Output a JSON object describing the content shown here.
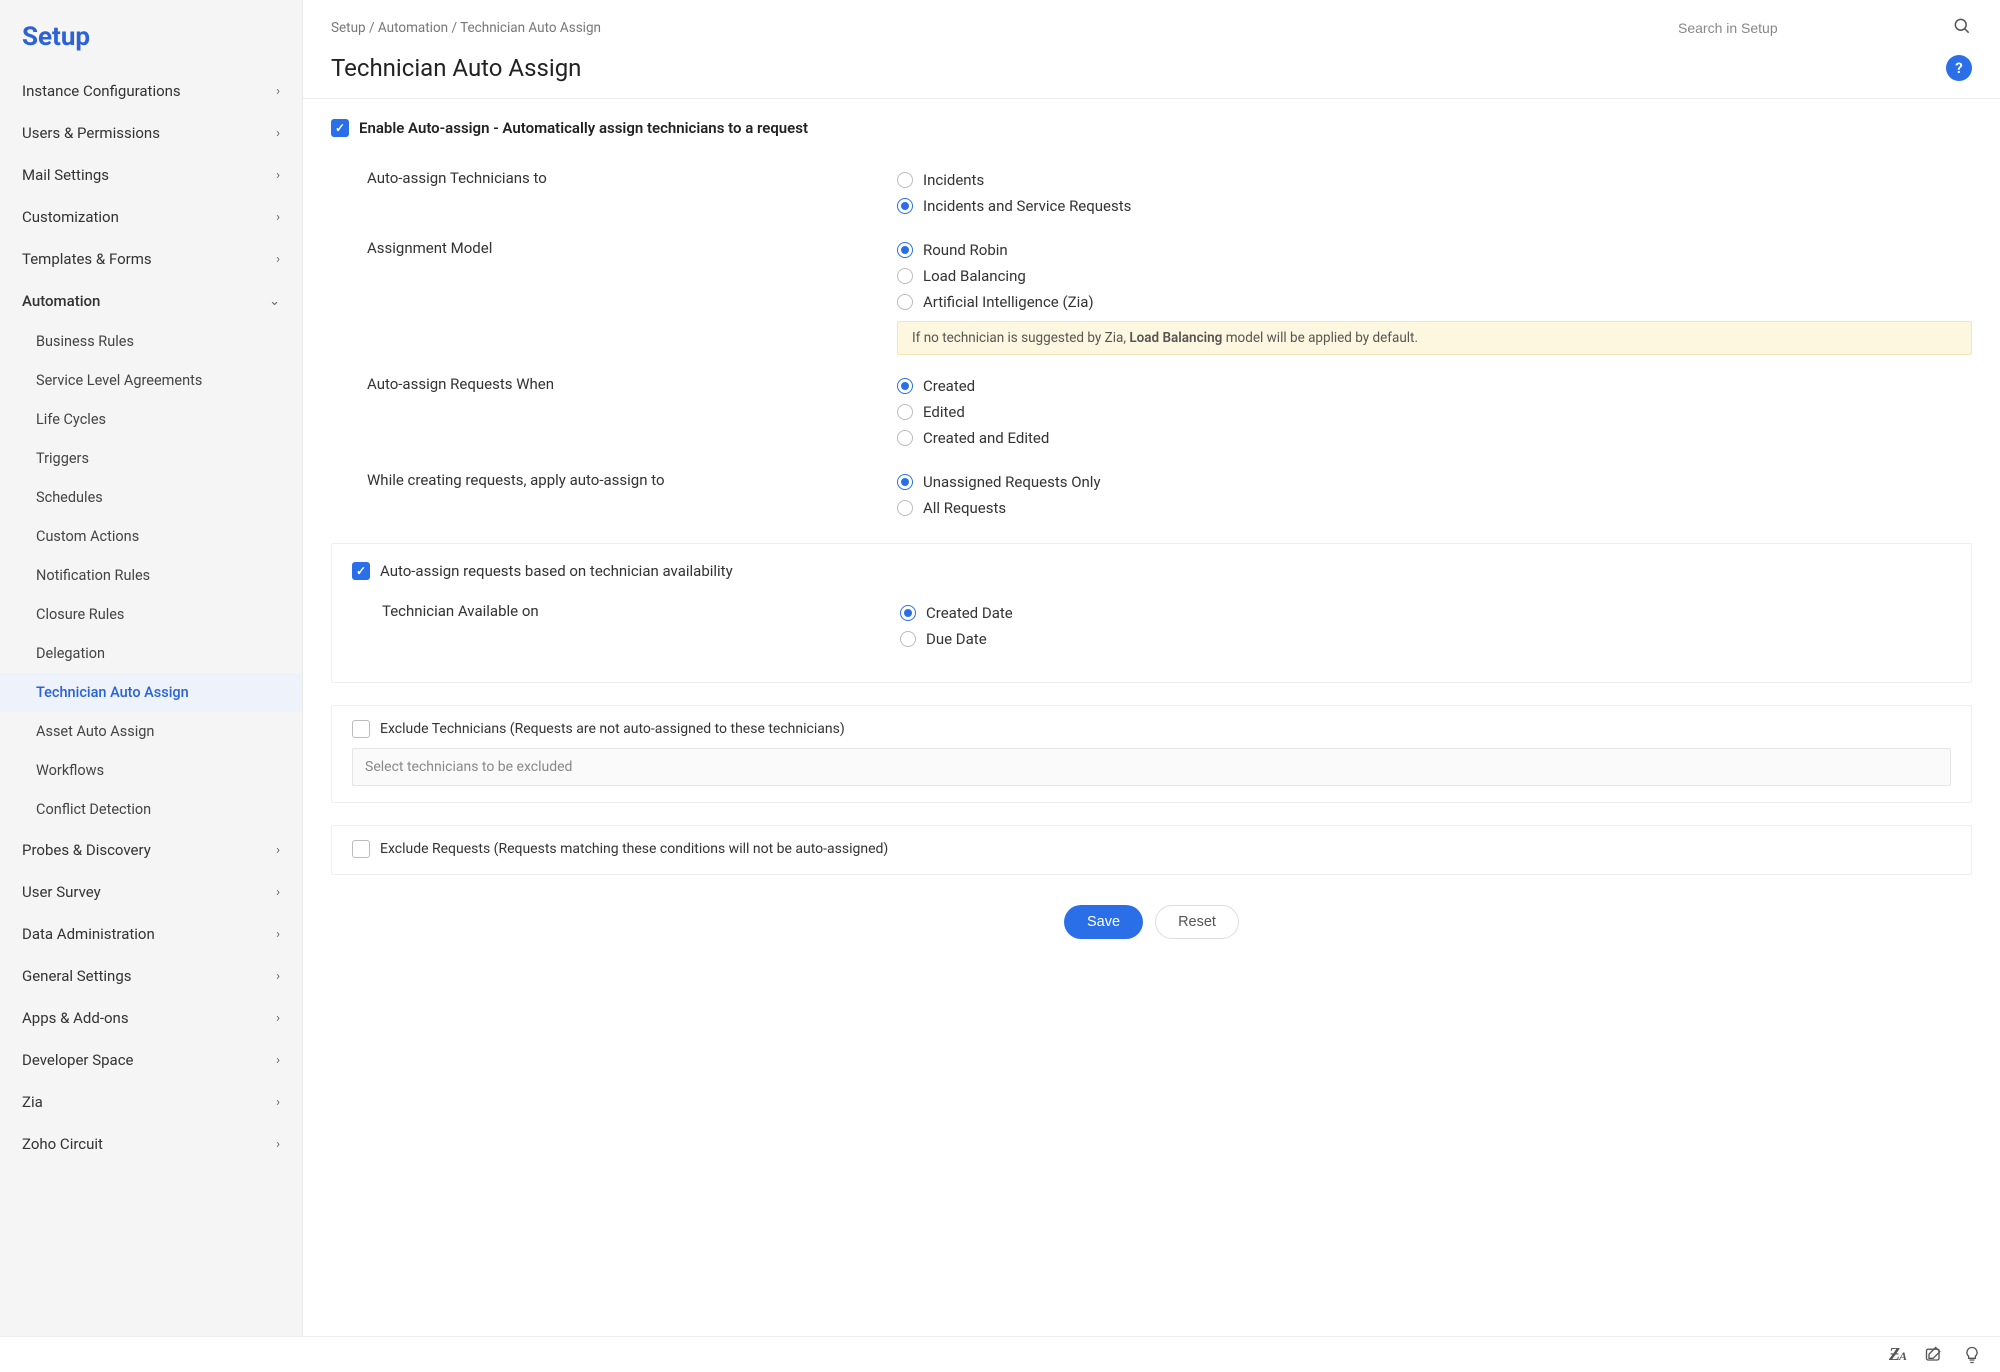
{
  "sidebar": {
    "title": "Setup",
    "items": [
      {
        "label": "Instance Configurations",
        "expandable": true
      },
      {
        "label": "Users & Permissions",
        "expandable": true
      },
      {
        "label": "Mail Settings",
        "expandable": true
      },
      {
        "label": "Customization",
        "expandable": true
      },
      {
        "label": "Templates & Forms",
        "expandable": true
      },
      {
        "label": "Automation",
        "expandable": true,
        "expanded": true,
        "children": [
          {
            "label": "Business Rules"
          },
          {
            "label": "Service Level Agreements"
          },
          {
            "label": "Life Cycles"
          },
          {
            "label": "Triggers"
          },
          {
            "label": "Schedules"
          },
          {
            "label": "Custom Actions"
          },
          {
            "label": "Notification Rules"
          },
          {
            "label": "Closure Rules"
          },
          {
            "label": "Delegation"
          },
          {
            "label": "Technician Auto Assign",
            "active": true
          },
          {
            "label": "Asset Auto Assign"
          },
          {
            "label": "Workflows"
          },
          {
            "label": "Conflict Detection"
          }
        ]
      },
      {
        "label": "Probes & Discovery",
        "expandable": true
      },
      {
        "label": "User Survey",
        "expandable": true
      },
      {
        "label": "Data Administration",
        "expandable": true
      },
      {
        "label": "General Settings",
        "expandable": true
      },
      {
        "label": "Apps & Add-ons",
        "expandable": true
      },
      {
        "label": "Developer Space",
        "expandable": true
      },
      {
        "label": "Zia",
        "expandable": true
      },
      {
        "label": "Zoho Circuit",
        "expandable": true
      }
    ]
  },
  "breadcrumb": {
    "a": "Setup",
    "b": "Automation",
    "c": "Technician Auto Assign"
  },
  "search": {
    "placeholder": "Search in Setup"
  },
  "page": {
    "title": "Technician Auto Assign"
  },
  "form": {
    "enable_label": "Enable Auto-assign - Automatically assign technicians to a request",
    "enable_checked": true,
    "row1": {
      "label": "Auto-assign Technicians to",
      "opts": [
        "Incidents",
        "Incidents and Service Requests"
      ],
      "selected": 1
    },
    "row2": {
      "label": "Assignment Model",
      "opts": [
        "Round Robin",
        "Load Balancing",
        "Artificial Intelligence (Zia)"
      ],
      "selected": 0,
      "alert_pre": "If no technician is suggested by Zia, ",
      "alert_bold": "Load Balancing",
      "alert_post": " model will be applied by default."
    },
    "row3": {
      "label": "Auto-assign Requests When",
      "opts": [
        "Created",
        "Edited",
        "Created and Edited"
      ],
      "selected": 0
    },
    "row4": {
      "label": "While creating requests, apply auto-assign to",
      "opts": [
        "Unassigned Requests Only",
        "All Requests"
      ],
      "selected": 0
    },
    "avail": {
      "cb_label": "Auto-assign requests based on technician availability",
      "cb_checked": true,
      "label": "Technician Available on",
      "opts": [
        "Created Date",
        "Due Date"
      ],
      "selected": 0
    },
    "excl_tech": {
      "label": "Exclude Technicians (Requests are not auto-assigned to these technicians)",
      "checked": false,
      "placeholder": "Select technicians to be excluded"
    },
    "excl_req": {
      "label": "Exclude Requests (Requests matching these conditions will not be auto-assigned)",
      "checked": false
    }
  },
  "buttons": {
    "save": "Save",
    "reset": "Reset"
  }
}
